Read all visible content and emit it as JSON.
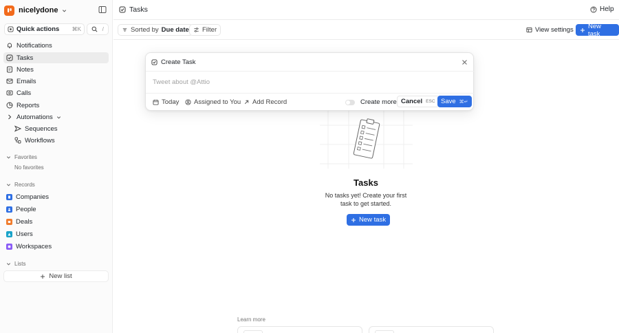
{
  "workspace": {
    "name": "nicelydone",
    "brand_color": "#f26a1b"
  },
  "quick_actions": {
    "label": "Quick actions",
    "shortcut": "⌘K",
    "search_shortcut": "/"
  },
  "nav": [
    {
      "label": "Notifications",
      "icon": "bell-icon"
    },
    {
      "label": "Tasks",
      "icon": "check-square-icon",
      "active": true
    },
    {
      "label": "Notes",
      "icon": "note-icon"
    },
    {
      "label": "Emails",
      "icon": "mail-icon"
    },
    {
      "label": "Calls",
      "icon": "phone-icon"
    },
    {
      "label": "Reports",
      "icon": "report-icon"
    },
    {
      "label": "Automations",
      "icon": "automation-icon"
    }
  ],
  "automations": [
    {
      "label": "Sequences",
      "icon": "sequence-icon"
    },
    {
      "label": "Workflows",
      "icon": "workflow-icon"
    }
  ],
  "favorites": {
    "title": "Favorites",
    "empty": "No favorites"
  },
  "records": {
    "title": "Records",
    "items": [
      {
        "label": "Companies",
        "color": "#2f6fe3"
      },
      {
        "label": "People",
        "color": "#2f6fe3"
      },
      {
        "label": "Deals",
        "color": "#f07c2e"
      },
      {
        "label": "Users",
        "color": "#1aa3c9"
      },
      {
        "label": "Workspaces",
        "color": "#8b5cf6"
      }
    ]
  },
  "lists": {
    "title": "Lists",
    "new_list": "New list"
  },
  "header": {
    "title": "Tasks",
    "help": "Help"
  },
  "toolbar": {
    "sorted_prefix": "Sorted by",
    "sorted_value": "Due date",
    "filter": "Filter",
    "view_settings": "View settings",
    "new_task": "New task"
  },
  "modal": {
    "title": "Create Task",
    "placeholder": "Tweet about @Attio",
    "today": "Today",
    "assigned": "Assigned to You",
    "add_record": "Add Record",
    "create_more": "Create more",
    "cancel": "Cancel",
    "cancel_kbd": "ESC",
    "save": "Save",
    "save_kbd": "⌘↵"
  },
  "empty_state": {
    "title": "Tasks",
    "description": "No tasks yet! Create your first task to get started.",
    "button": "New task"
  },
  "learn_more": "Learn more"
}
